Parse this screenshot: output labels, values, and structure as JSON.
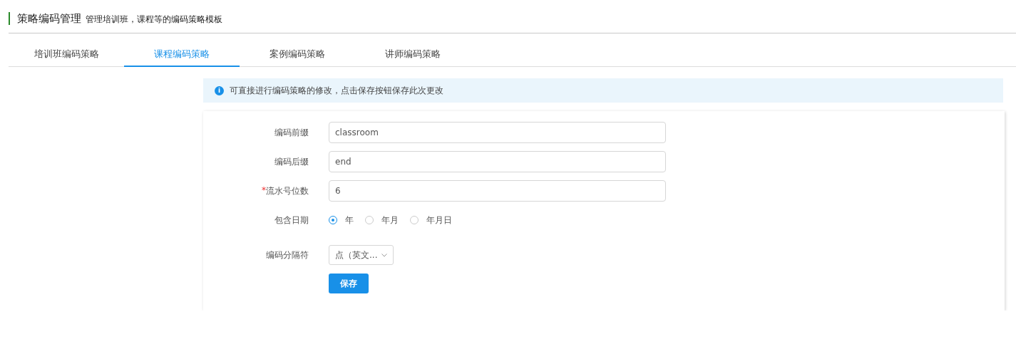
{
  "header": {
    "title": "策略编码管理",
    "subtitle": "管理培训班，课程等的编码策略模板"
  },
  "tabs": [
    {
      "label": "培训班编码策略",
      "selected": false
    },
    {
      "label": "课程编码策略",
      "selected": true
    },
    {
      "label": "案例编码策略",
      "selected": false
    },
    {
      "label": "讲师编码策略",
      "selected": false
    }
  ],
  "notice": {
    "icon": "i",
    "text": "可直接进行编码策略的修改，点击保存按钮保存此次更改"
  },
  "form": {
    "fields": [
      {
        "kind": "text",
        "label": "编码前缀",
        "value": "classroom"
      },
      {
        "kind": "text",
        "label": "编码后缀",
        "value": "end"
      },
      {
        "kind": "text",
        "label": "流水号位数",
        "required_mark": "*",
        "value": "6"
      },
      {
        "kind": "radio",
        "label": "包含日期",
        "options": [
          {
            "label": "年",
            "selected": true
          },
          {
            "label": "年月",
            "selected": false
          },
          {
            "label": "年月日",
            "selected": false
          }
        ]
      },
      {
        "kind": "select",
        "label": "编码分隔符",
        "value": "点（英文..."
      }
    ],
    "save_button": "保存"
  }
}
